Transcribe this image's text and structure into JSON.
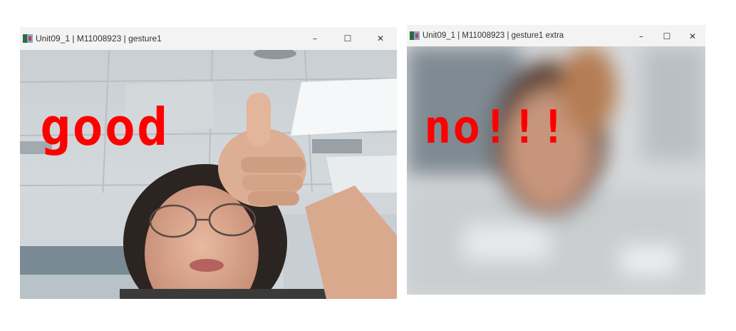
{
  "windows": [
    {
      "title": "Unit09_1 | M11008923 | gesture1",
      "controls": {
        "minimize": "–",
        "maximize": "☐",
        "close": "✕"
      },
      "overlay_text": "good"
    },
    {
      "title": "Unit09_1 | M11008923 | gesture1 extra",
      "controls": {
        "minimize": "–",
        "maximize": "☐",
        "close": "✕"
      },
      "overlay_text": "no!!!"
    }
  ],
  "colors": {
    "overlay_text": "#ff0000",
    "titlebar": "#f3f3f3"
  }
}
